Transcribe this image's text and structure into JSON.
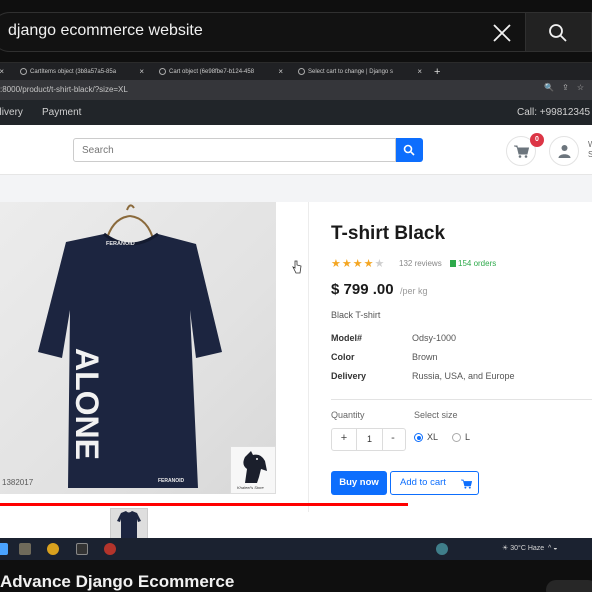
{
  "yt": {
    "search_query": "django ecommerce website",
    "video_title": "Advance Django Ecommerce",
    "progress": 0.69
  },
  "browser": {
    "tabs": [
      {
        "label": "CartItems object (3b8a57a5-85a"
      },
      {
        "label": "Cart object (6e98fbe7-b124-458"
      },
      {
        "label": "Select cart to change | Django s"
      }
    ],
    "url": ":8000/product/t-shirt-black/?size=XL"
  },
  "topbar": {
    "nav_delivery": "elivery",
    "nav_payment": "Payment",
    "call": "Call: +99812345"
  },
  "header": {
    "search_placeholder": "Search",
    "cart_count": "0"
  },
  "product": {
    "title": "T-shirt Black",
    "rating": 4,
    "rating_max": 5,
    "reviews": "132 reviews",
    "orders": "154 orders",
    "price": "$ 799 .00",
    "per_unit": "/per kg",
    "description": "Black T-shirt",
    "specs": [
      {
        "key": "Model#",
        "value": "Odsy-1000"
      },
      {
        "key": "Color",
        "value": "Brown"
      },
      {
        "key": "Delivery",
        "value": "Russia, USA, and Europe"
      }
    ],
    "quantity_label": "Quantity",
    "quantity": "1",
    "minus": "-",
    "plus": "+",
    "size_label": "Select size",
    "sizes": [
      {
        "label": "XL",
        "selected": true
      },
      {
        "label": "L",
        "selected": false
      }
    ],
    "buy_now": "Buy now",
    "add_to_cart": "Add to cart",
    "shirt_print": "ALONE",
    "shirt_brand": "FERANOID",
    "photo_code": "1382017",
    "badge_caption": "Khaleel's Store"
  },
  "taskbar": {
    "weather": "30°C  Haze"
  },
  "colors": {
    "primary": "#0d6efd",
    "badge": "#dc3545",
    "star": "#f4a623",
    "orders": "#2eaa4b",
    "shirt": "#1c2540",
    "progress": "#ff0000"
  }
}
